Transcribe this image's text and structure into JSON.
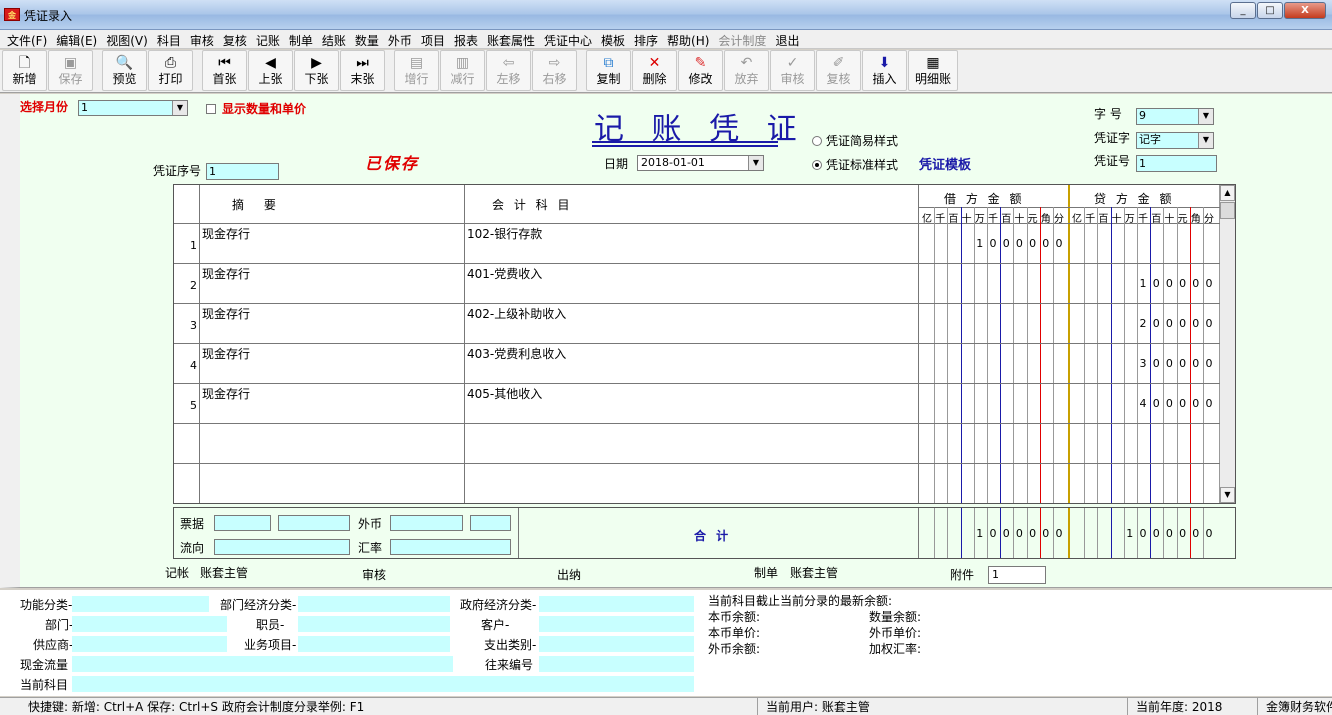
{
  "window": {
    "title": "凭证录入",
    "icon_text": "金",
    "minimize": "_",
    "maximize": "□",
    "close": "X"
  },
  "menu": [
    "文件(F)",
    "编辑(E)",
    "视图(V)",
    "科目",
    "审核",
    "复核",
    "记账",
    "制单",
    "结账",
    "数量",
    "外币",
    "项目",
    "报表",
    "账套属性",
    "凭证中心",
    "模板",
    "排序",
    "帮助(H)",
    "会计制度",
    "退出"
  ],
  "toolbar": {
    "new": "新增",
    "save": "保存",
    "preview": "预览",
    "print": "打印",
    "first": "首张",
    "prev": "上张",
    "next": "下张",
    "last": "末张",
    "add_row": "增行",
    "del_row": "减行",
    "move_left": "左移",
    "move_right": "右移",
    "copy": "复制",
    "delete": "删除",
    "modify": "修改",
    "abandon": "放弃",
    "audit": "审核",
    "recheck": "复核",
    "insert": "插入",
    "ledger": "明细账"
  },
  "header": {
    "month_label": "选择月份",
    "month_value": "1",
    "show_qty_label": "显示数量和单价",
    "voucher_title": "记 账 凭 证",
    "saved_stamp": "已保存",
    "date_label": "日期",
    "date_value": "2018-01-01",
    "seq_label": "凭证序号",
    "seq_value": "1",
    "style_simple": "凭证简易样式",
    "style_standard": "凭证标准样式",
    "template_label": "凭证模板",
    "zihao_label": "字 号",
    "zihao_value": "9",
    "voucher_word_label": "凭证字",
    "voucher_word_value": "记字",
    "voucher_no_label": "凭证号",
    "voucher_no_value": "1"
  },
  "grid": {
    "col_summary": "摘 要",
    "col_account": "会 计 科 目",
    "col_debit": "借 方 金 额",
    "col_credit": "贷 方 金 额",
    "digit_units": [
      "亿",
      "千",
      "百",
      "十",
      "万",
      "千",
      "百",
      "十",
      "元",
      "角",
      "分"
    ],
    "rows": [
      {
        "num": "1",
        "summary": "现金存行",
        "account": "102-银行存款",
        "debit": "1000000",
        "credit": ""
      },
      {
        "num": "2",
        "summary": "现金存行",
        "account": "401-党费收入",
        "debit": "",
        "credit": "100000"
      },
      {
        "num": "3",
        "summary": "现金存行",
        "account": "402-上级补助收入",
        "debit": "",
        "credit": "200000"
      },
      {
        "num": "4",
        "summary": "现金存行",
        "account": "403-党费利息收入",
        "debit": "",
        "credit": "300000"
      },
      {
        "num": "5",
        "summary": "现金存行",
        "account": "405-其他收入",
        "debit": "",
        "credit": "400000"
      }
    ],
    "total_label": "合 计",
    "total_debit": "1000000",
    "total_credit": "1000000"
  },
  "sum_area": {
    "bill_label": "票据",
    "currency_label": "外币",
    "flow_label": "流向",
    "rate_label": "汇率"
  },
  "signatures": {
    "post_label": "记帐",
    "post_value": "账套主管",
    "audit_label": "审核",
    "cashier_label": "出纳",
    "maker_label": "制单",
    "maker_value": "账套主管",
    "attach_label": "附件",
    "attach_value": "1"
  },
  "bottom": {
    "func_class": "功能分类-",
    "dept_econ": "部门经济分类-",
    "gov_econ": "政府经济分类-",
    "dept": "部门-",
    "staff": "职员-",
    "customer": "客户-",
    "supplier": "供应商-",
    "project": "业务项目-",
    "expense_type": "支出类别-",
    "cash_flow": "现金流量",
    "contact_no": "往来编号",
    "current_account": "当前科目",
    "balance_title": "当前科目截止当前分录的最新余额:",
    "local_balance": "本币余额:",
    "qty_balance": "数量余额:",
    "local_price": "本币单价:",
    "foreign_price": "外币单价:",
    "foreign_balance": "外币余额:",
    "weighted_rate": "加权汇率:"
  },
  "status": {
    "shortcuts": "快捷键: 新增: Ctrl+A  保存: Ctrl+S  政府会计制度分录举例: F1",
    "user": "当前用户: 账套主管",
    "year": "当前年度: 2018",
    "brand": "金簿财务软件"
  }
}
